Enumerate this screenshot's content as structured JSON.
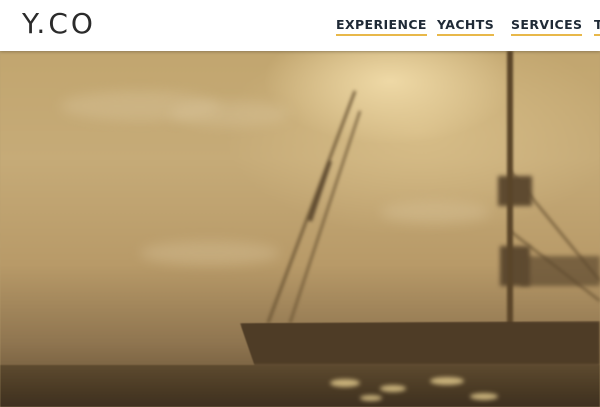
{
  "brand": {
    "logo_text": "Y.CO"
  },
  "nav": {
    "items": [
      {
        "label": "EXPERIENCE"
      },
      {
        "label": "YACHTS"
      },
      {
        "label": "SERVICES"
      },
      {
        "label": "T"
      }
    ]
  },
  "hero": {
    "image_subject": "sailing-yacht-silhouette-sunset"
  },
  "colors": {
    "header_bg": "#ffffff",
    "nav_text": "#1f2a36",
    "nav_underline": "#e8b84a",
    "hero_tone": "#b8a070"
  }
}
